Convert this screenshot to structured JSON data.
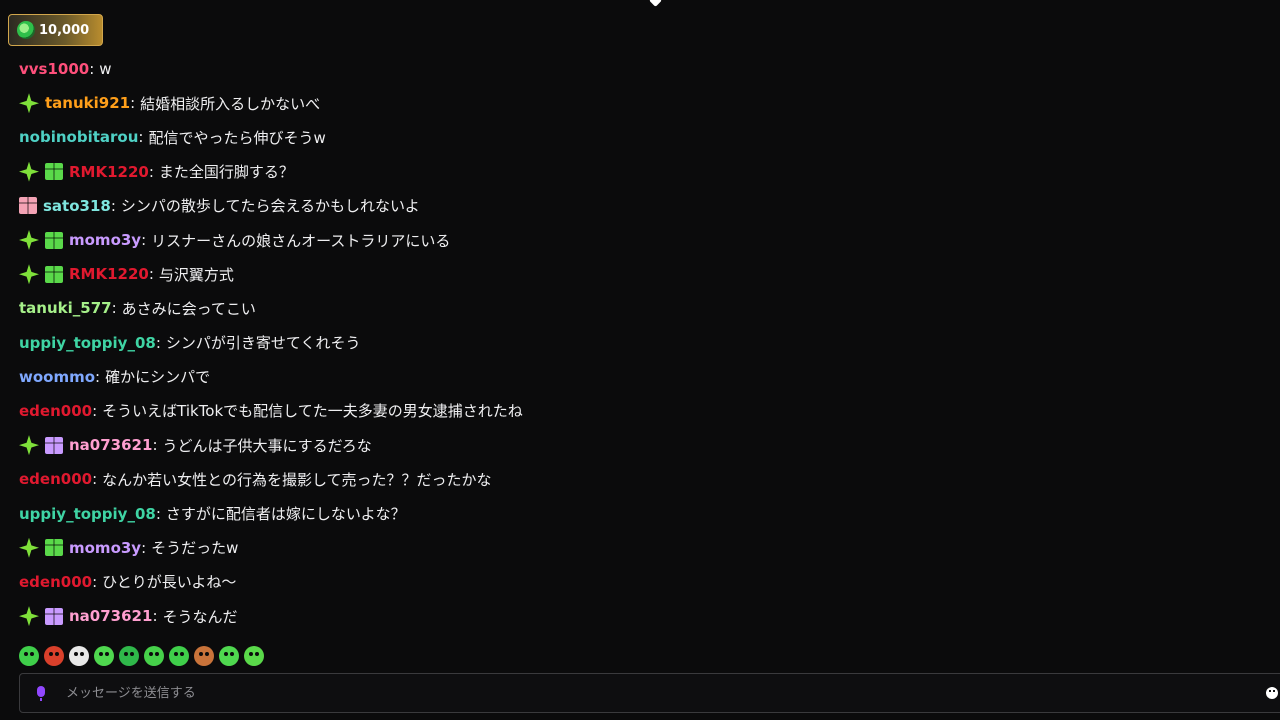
{
  "points": {
    "value": "10,000"
  },
  "chat": {
    "messages": [
      {
        "badges": [],
        "username": "vvs1000",
        "color": "#ff4f7b",
        "text": "w"
      },
      {
        "badges": [
          "sparkle"
        ],
        "username": "tanuki921",
        "color": "#ff9f1a",
        "text": "結婚相談所入るしかないべ"
      },
      {
        "badges": [],
        "username": "nobinobitarou",
        "color": "#4fd1c5",
        "text": "配信でやったら伸びそうw"
      },
      {
        "badges": [
          "sparkle",
          "gift-green"
        ],
        "username": "RMK1220",
        "color": "#e0192f",
        "text": "また全国行脚する？"
      },
      {
        "badges": [
          "gift-pink"
        ],
        "username": "sato318",
        "color": "#7fe6df",
        "text": "シンパの散歩してたら会えるかもしれないよ"
      },
      {
        "badges": [
          "sparkle",
          "gift-green"
        ],
        "username": "momo3y",
        "color": "#c99bff",
        "text": "リスナーさんの娘さんオーストラリアにいる"
      },
      {
        "badges": [
          "sparkle",
          "gift-green"
        ],
        "username": "RMK1220",
        "color": "#e0192f",
        "text": "与沢翼方式"
      },
      {
        "badges": [],
        "username": "tanuki_577",
        "color": "#a6f08a",
        "text": "あさみに会ってこい"
      },
      {
        "badges": [],
        "username": "uppiy_toppiy_08",
        "color": "#3fd4a4",
        "text": "シンパが引き寄せてくれそう"
      },
      {
        "badges": [],
        "username": "woommo",
        "color": "#7fa8ff",
        "text": "確かにシンパで"
      },
      {
        "badges": [],
        "username": "eden000",
        "color": "#e0192f",
        "text": "そういえばTikTokでも配信してた一夫多妻の男女逮捕されたね"
      },
      {
        "badges": [
          "sparkle",
          "gift-purple"
        ],
        "username": "na073621",
        "color": "#ff9fd0",
        "text": "うどんは子供大事にするだろな"
      },
      {
        "badges": [],
        "username": "eden000",
        "color": "#e0192f",
        "text": "なんか若い女性との行為を撮影して売った？？だったかな"
      },
      {
        "badges": [],
        "username": "uppiy_toppiy_08",
        "color": "#3fd4a4",
        "text": "さすがに配信者は嫁にしないよな？"
      },
      {
        "badges": [
          "sparkle",
          "gift-green"
        ],
        "username": "momo3y",
        "color": "#c99bff",
        "text": "そうだったw"
      },
      {
        "badges": [],
        "username": "eden000",
        "color": "#e0192f",
        "text": "ひとりが長いよね〜"
      },
      {
        "badges": [
          "sparkle",
          "gift-purple"
        ],
        "username": "na073621",
        "color": "#ff9fd0",
        "text": "そうなんだ"
      }
    ]
  },
  "emotes": [
    {
      "name": "emote-1",
      "color": "#3fcf4a"
    },
    {
      "name": "emote-2",
      "color": "#d9402b"
    },
    {
      "name": "emote-3",
      "color": "#e8e8e8"
    },
    {
      "name": "emote-4",
      "color": "#4fd84f"
    },
    {
      "name": "emote-5",
      "color": "#2fb84a"
    },
    {
      "name": "emote-6",
      "color": "#46d14a"
    },
    {
      "name": "emote-7",
      "color": "#3fcf4a"
    },
    {
      "name": "emote-8",
      "color": "#c9733a"
    },
    {
      "name": "emote-9",
      "color": "#4fd84f"
    },
    {
      "name": "emote-10",
      "color": "#5ad94a"
    }
  ],
  "input": {
    "placeholder": "メッセージを送信する"
  },
  "badge_colors": {
    "sparkle": "#7fe03a",
    "gift-green": "#5ad94a",
    "gift-pink": "#f4a3b5",
    "gift-purple": "#c99bff"
  }
}
